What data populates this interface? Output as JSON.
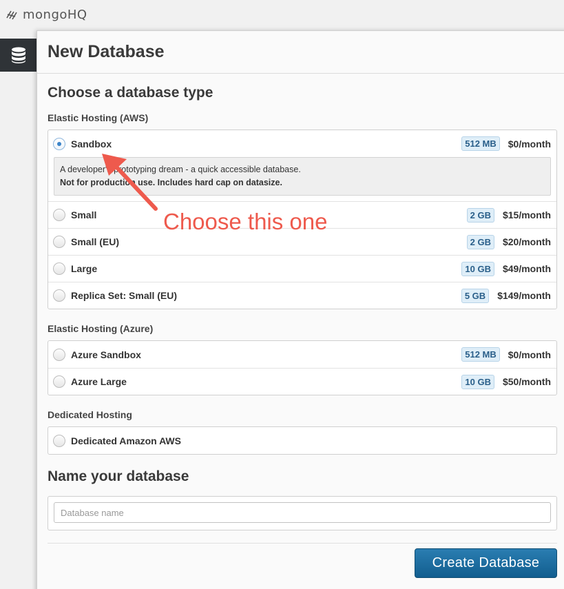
{
  "app": {
    "logo_text": "mongoHQ"
  },
  "panel": {
    "title": "New Database"
  },
  "section_type": {
    "title": "Choose a database type"
  },
  "groups": {
    "aws": {
      "label": "Elastic Hosting (AWS)",
      "options": [
        {
          "label": "Sandbox",
          "size": "512 MB",
          "price": "$0/month",
          "selected": true,
          "desc_line1": "A developer's prototyping dream - a quick accessible database.",
          "desc_line2": "Not for production use. Includes hard cap on datasize."
        },
        {
          "label": "Small",
          "size": "2 GB",
          "price": "$15/month"
        },
        {
          "label": "Small (EU)",
          "size": "2 GB",
          "price": "$20/month"
        },
        {
          "label": "Large",
          "size": "10 GB",
          "price": "$49/month"
        },
        {
          "label": "Replica Set: Small (EU)",
          "size": "5 GB",
          "price": "$149/month"
        }
      ]
    },
    "azure": {
      "label": "Elastic Hosting (Azure)",
      "options": [
        {
          "label": "Azure Sandbox",
          "size": "512 MB",
          "price": "$0/month"
        },
        {
          "label": "Azure Large",
          "size": "10 GB",
          "price": "$50/month"
        }
      ]
    },
    "dedicated": {
      "label": "Dedicated Hosting",
      "options": [
        {
          "label": "Dedicated Amazon AWS"
        }
      ]
    }
  },
  "section_name": {
    "title": "Name your database",
    "placeholder": "Database name",
    "value": ""
  },
  "actions": {
    "create_label": "Create Database"
  },
  "annotation": {
    "text": "Choose this one"
  },
  "colors": {
    "accent": "#1b6ea3",
    "annotation": "#ee5a4d",
    "badge_bg": "#dfeef8"
  },
  "icons": {
    "nav": "database-icon",
    "logo": "mongohq-leaf-icon"
  }
}
